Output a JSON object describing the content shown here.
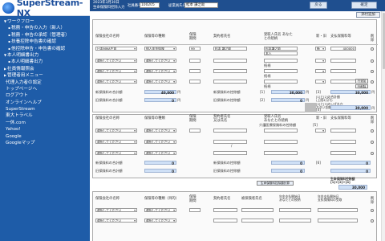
{
  "app": {
    "logo_text": "SuperStream-NX"
  },
  "sidebar": {
    "items": [
      {
        "label": "ワークフロー",
        "marker": "▼"
      },
      {
        "label": "税務・申告の入力（新人）",
        "marker": "▪"
      },
      {
        "label": "税務・申告の承認（管理者）",
        "marker": "▪"
      },
      {
        "label": "扶養控除申告書の確認",
        "marker": "▪"
      },
      {
        "label": "他控除申告・申告書の確認",
        "marker": "▪"
      },
      {
        "label": "本人明細書出力",
        "marker": "▼"
      },
      {
        "label": "本人明細書出力",
        "marker": "▪"
      },
      {
        "label": "社員情報照会",
        "marker": "▶"
      },
      {
        "label": "管理者用メニュー",
        "marker": "▶"
      },
      {
        "label": "代理入力者の設定",
        "marker": ""
      },
      {
        "label": "トップページへ",
        "marker": ""
      },
      {
        "label": "ログアウト",
        "marker": ""
      },
      {
        "label": "オンラインヘルプ",
        "marker": ""
      },
      {
        "label": "SuperStream",
        "marker": ""
      },
      {
        "label": "東大トラベル",
        "marker": ""
      },
      {
        "label": "一休.com",
        "marker": ""
      },
      {
        "label": "Yahoo!",
        "marker": ""
      },
      {
        "label": "Google",
        "marker": ""
      },
      {
        "label": "Googleマップ",
        "marker": ""
      }
    ]
  },
  "header": {
    "line1": "2023年3月30日",
    "line2": "生命保険料控除入力",
    "company_label": "社員番号",
    "company_value": "100205",
    "name_label": "従業員氏名",
    "name_value": "松本 謙之助",
    "back_label": "戻る",
    "confirm_label": "確定",
    "attach_label": "添付追加"
  },
  "section1": {
    "headers": {
      "company": "保険会社の名称",
      "type": "保険等の種類",
      "period": "保険期間",
      "contractor": "契約者氏名",
      "recipient": "受取人氏名\nあなたとの続柄",
      "new_old": "新・旧",
      "premium": "支払保険料等",
      "delete": "削除"
    },
    "row1": {
      "company": "日本MMA生命",
      "type": "個人年金保険",
      "period": "99",
      "contractor": "松本 謙之助",
      "recipient": "松本謙之助",
      "relation": "本人",
      "new_old": "新",
      "premium": "400000"
    },
    "placeholder": "選択してください",
    "relation_label": "続柄",
    "add_row": "行追加",
    "del_row": "行削除",
    "totals": {
      "new_total_label": "新保険料の合計額",
      "new_total": "40,000",
      "new_deduct_label": "新保険料の控除額",
      "new_deduct_marker": "[1]",
      "new_deduct": "30,000",
      "old_total_label": "旧保険料の合計額",
      "old_total": "0",
      "old_deduct_label": "旧保険料の控除額",
      "old_deduct_marker": "[2]",
      "combined_label": "[1]と[2]の合計額\n(上限4万円)",
      "combined_marker": "[3]",
      "combined": "30,000",
      "comparison_label": "[2]と[3]のいずれか\n大きい金額",
      "comparison_marker": "[4]",
      "comparison": "30,000",
      "yen": "円"
    }
  },
  "section2": {
    "headers": {
      "company": "保険会社の名称",
      "type": "保険等の種類",
      "period": "保険期間",
      "contractor": "契約者氏名\n又は氏名",
      "recipient": "受取人氏名\nあなたとの続柄",
      "new_old": "新・旧",
      "premium": "支払保険料等",
      "delete": "削除"
    },
    "care_label": "介護医療保険料の控除額",
    "care_marker": "[5]",
    "care_value": "0",
    "date_sep": "/",
    "totals": {
      "new_total": "0",
      "old_total": "0",
      "new_deduct": "0",
      "old_deduct": "0",
      "deduct_marker": "[6]",
      "combined": "0",
      "comparison": "0",
      "grand_label": "生命保険料控除額\n[1]+[2]+[4]",
      "grand_value": "30,000",
      "calc_button": "生命保険料控除額計算"
    }
  },
  "section3": {
    "headers": {
      "company": "保険会社の名称",
      "type": "保険等の種類（目的）",
      "period": "保険期間",
      "contractor": "契約者氏名",
      "insured": "被保険者氏名",
      "annuity": "年金支払開始日\nあなたとの続柄",
      "start": "年金支払開始日\n支払保険料の受取",
      "delete": "削除"
    }
  }
}
